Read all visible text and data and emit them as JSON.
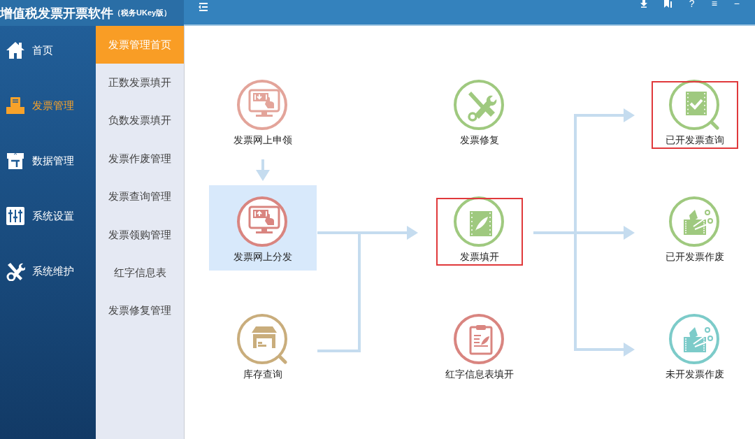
{
  "window": {
    "title": "增值税发票开票软件",
    "subtitle": "（税务UKey版）"
  },
  "toolbar": {
    "buttons": [
      {
        "kind": "download"
      },
      {
        "kind": "bookmark"
      },
      {
        "kind": "text",
        "label": "?"
      },
      {
        "kind": "text",
        "label": "≡"
      },
      {
        "kind": "text",
        "label": "−"
      }
    ]
  },
  "nav": {
    "items": [
      {
        "label": "首页",
        "kind": "home",
        "selected": false
      },
      {
        "label": "发票管理",
        "kind": "tray",
        "selected": true
      },
      {
        "label": "数据管理",
        "kind": "data",
        "selected": false
      },
      {
        "label": "系统设置",
        "kind": "sliders",
        "selected": false
      },
      {
        "label": "系统维护",
        "kind": "tools",
        "selected": false
      }
    ]
  },
  "submenu": {
    "items": [
      {
        "label": "发票管理首页",
        "selected": true
      },
      {
        "label": "正数发票填开",
        "selected": false
      },
      {
        "label": "负数发票填开",
        "selected": false
      },
      {
        "label": "发票作废管理",
        "selected": false
      },
      {
        "label": "发票查询管理",
        "selected": false
      },
      {
        "label": "发票领购管理",
        "selected": false
      },
      {
        "label": "红字信息表",
        "selected": false
      },
      {
        "label": "发票修复管理",
        "selected": false
      }
    ]
  },
  "flow": {
    "nodes": [
      {
        "label": "发票网上申领",
        "kind": "monitor-down",
        "color": "#e3a49a",
        "selected": false,
        "highlighted": false
      },
      {
        "label": "发票网上分发",
        "kind": "monitor-up",
        "color": "#d98580",
        "selected": true,
        "highlighted": false
      },
      {
        "label": "库存查询",
        "kind": "warehouse",
        "color": "#c9ad7c",
        "selected": false,
        "highlighted": false
      },
      {
        "label": "发票修复",
        "kind": "tools",
        "color": "#9fc97f",
        "selected": false,
        "highlighted": false
      },
      {
        "label": "发票填开",
        "kind": "film-feather",
        "color": "#9fc97f",
        "selected": false,
        "highlighted": true
      },
      {
        "label": "红字信息表填开",
        "kind": "clipboard",
        "color": "#d98580",
        "selected": false,
        "highlighted": false
      },
      {
        "label": "已开发票查询",
        "kind": "film-check",
        "color": "#9fc97f",
        "selected": false,
        "highlighted": true
      },
      {
        "label": "已开发票作废",
        "kind": "film-cut",
        "color": "#9fc97f",
        "selected": false,
        "highlighted": false
      },
      {
        "label": "未开发票作废",
        "kind": "film-cut",
        "color": "#7ccbc9",
        "selected": false,
        "highlighted": false
      }
    ]
  }
}
